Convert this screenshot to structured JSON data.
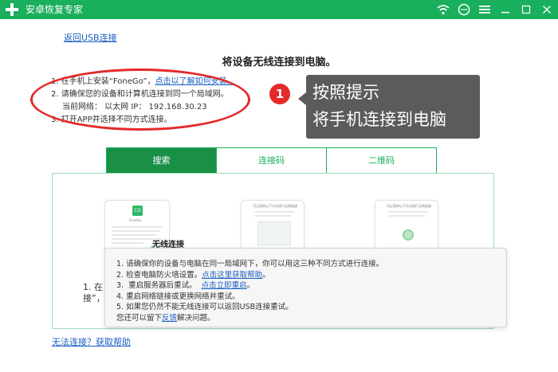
{
  "window": {
    "title": "安卓恢复专家"
  },
  "titlebar": {
    "icons": [
      "wifi-icon",
      "chat-icon",
      "menu-icon",
      "minimize-icon",
      "maximize-icon",
      "close-icon"
    ]
  },
  "back_link": "返回USB连接",
  "heading": "将设备无线连接到电脑。",
  "steps": {
    "s1_prefix": "1.  在手机上安装“FoneGo”，",
    "s1_link": "点击以了解如何安装。",
    "s2": "2.  请确保您的设备和计算机连接到同一个局域网。",
    "network_label": "当前网络：  以太网    IP：  192.168.30.23",
    "s3": "3.  打开APP并选择不同方式连接。"
  },
  "callout": {
    "badge": "1",
    "line1": "按照提示",
    "line2": "将手机连接到电脑"
  },
  "tabs": [
    {
      "label": "搜索",
      "active": true
    },
    {
      "label": "连接码",
      "active": false
    },
    {
      "label": "二维码",
      "active": false
    }
  ],
  "panel": {
    "card1_logo": "CG",
    "card1_app": "FoneGo",
    "card2_title": "可让您的以下方式进行无线连接",
    "card3_title": "可让您的以下方式进行无线连接",
    "wireless_label": "无线连接",
    "behind_line1": "1. 在",
    "behind_line2": "接”，"
  },
  "tooltip": {
    "l1": "1.  请确保你的设备与电脑在同一局域网下，你可以用这三种不同方式进行连接。",
    "l2_prefix": "2.  检查电脑防火墙设置。",
    "l2_link": "点击这里获取帮助",
    "l2_suffix": "。",
    "l3_prefix": "3.  重启服务器后重试。  ",
    "l3_link": "点击立即重启",
    "l3_suffix": "。",
    "l4": "4.  重启网络链接或更换网络并重试。",
    "l5": "5.  如果您仍然不能无线连接可以返回USB连接重试。",
    "l6_prefix": "您还可以留下",
    "l6_link": "反馈",
    "l6_suffix": "解决问题。"
  },
  "help_link": "无法连接？获取帮助",
  "colors": {
    "brand_green": "#1aaf5d",
    "active_tab": "#1a8f46",
    "annotation_red": "#e42a2a",
    "link_blue": "#1b5fc2"
  }
}
